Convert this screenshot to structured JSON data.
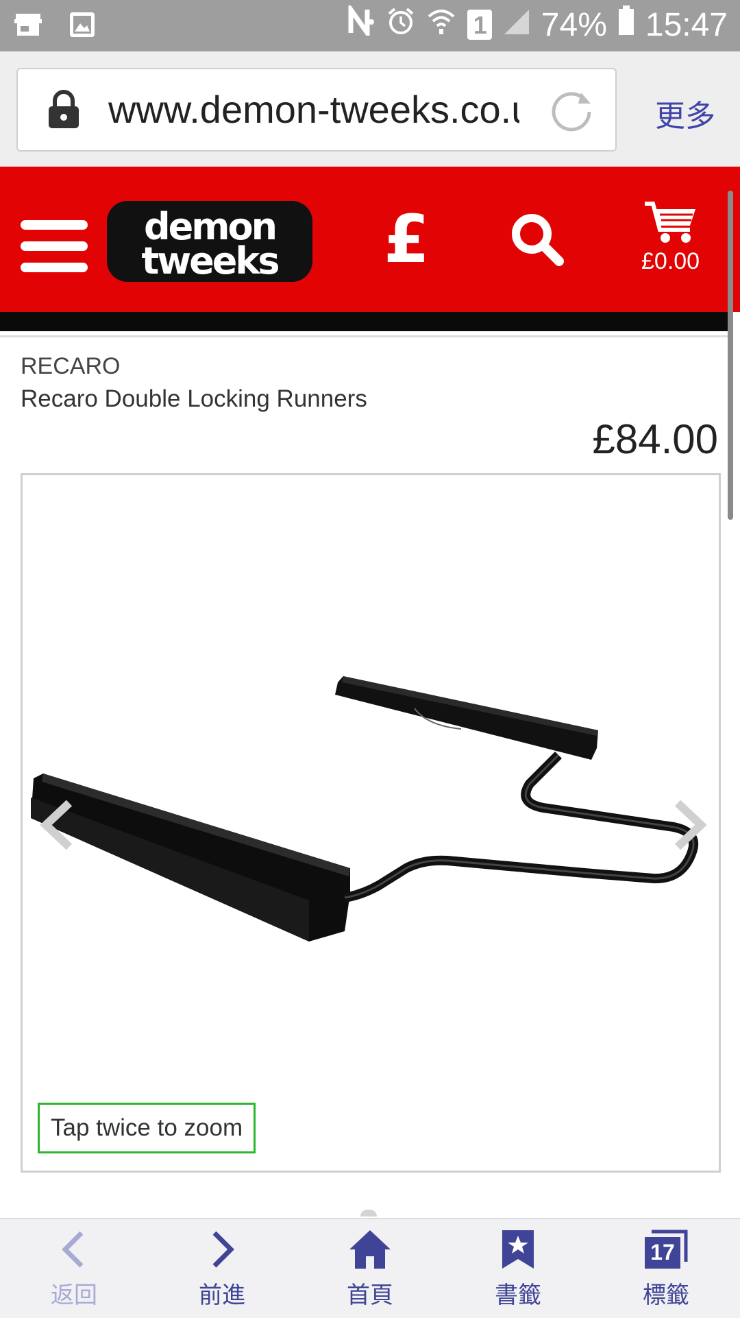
{
  "status_bar": {
    "battery": "74%",
    "time": "15:47",
    "sim_slot": "1"
  },
  "browser": {
    "url": "www.demon-tweeks.co.uk",
    "more_label": "更多"
  },
  "site_header": {
    "logo_line1": "demon",
    "logo_line2": "tweeks",
    "currency_symbol": "£",
    "cart_total": "£0.00"
  },
  "product": {
    "brand": "RECARO",
    "name": "Recaro Double Locking Runners",
    "price": "£84.00",
    "zoom_hint": "Tap twice to zoom"
  },
  "bottom_nav": {
    "back": "返回",
    "forward": "前進",
    "home": "首頁",
    "bookmarks": "書籤",
    "tabs": "標籤",
    "tab_count": "17"
  },
  "colors": {
    "header_red": "#e20404",
    "nav_accent": "#3f4496",
    "zoom_border": "#2db52d"
  }
}
